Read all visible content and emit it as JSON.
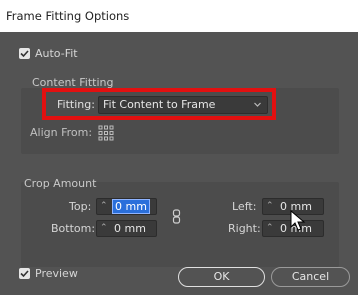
{
  "window": {
    "title": "Frame Fitting Options"
  },
  "auto_fit": {
    "label": "Auto-Fit",
    "checked": true
  },
  "content_fitting": {
    "heading": "Content Fitting",
    "fitting_label": "Fitting:",
    "fitting_value": "Fit Content to Frame",
    "align_from_label": "Align From:"
  },
  "crop_amount": {
    "heading": "Crop Amount",
    "top_label": "Top:",
    "top_value": "0 mm",
    "bottom_label": "Bottom:",
    "bottom_value": "0 mm",
    "left_label": "Left:",
    "left_value": "0 mm",
    "right_label": "Right:",
    "right_value": "0 mm"
  },
  "footer": {
    "preview_label": "Preview",
    "preview_checked": true,
    "ok_label": "OK",
    "cancel_label": "Cancel"
  },
  "colors": {
    "highlight": "#e21010",
    "panel": "#535353",
    "selection": "#2a6fdb"
  },
  "icons": [
    "checkbox-checked-icon",
    "chevron-down-icon",
    "reference-point-icon",
    "link-chain-icon",
    "spinner-arrows-icon",
    "mouse-cursor-icon"
  ]
}
